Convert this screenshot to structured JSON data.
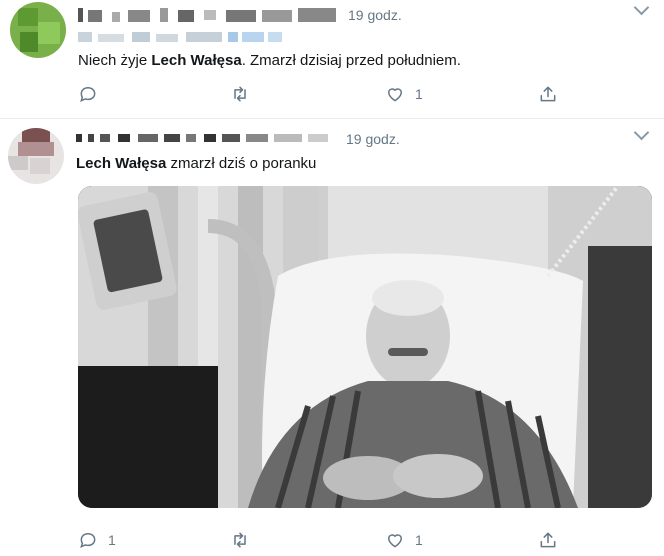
{
  "tweets": [
    {
      "time": "19 godz.",
      "text_bold": "Lech Wałęsa",
      "text_before": "Niech żyje ",
      "text_after": ". Zmarzł dzisiaj przed południem.",
      "replies": "",
      "likes": "1"
    },
    {
      "time": "19 godz.",
      "text_bold": "Lech Wałęsa",
      "text_before": "",
      "text_after": " zmarzł dziś o poranku",
      "replies": "1",
      "likes": "1"
    }
  ],
  "colors": {
    "muted": "#657786",
    "divider": "#e6ecf0",
    "text": "#14171a"
  },
  "icons": [
    "reply-icon",
    "retweet-icon",
    "like-icon",
    "share-icon",
    "chevron-down-icon"
  ]
}
